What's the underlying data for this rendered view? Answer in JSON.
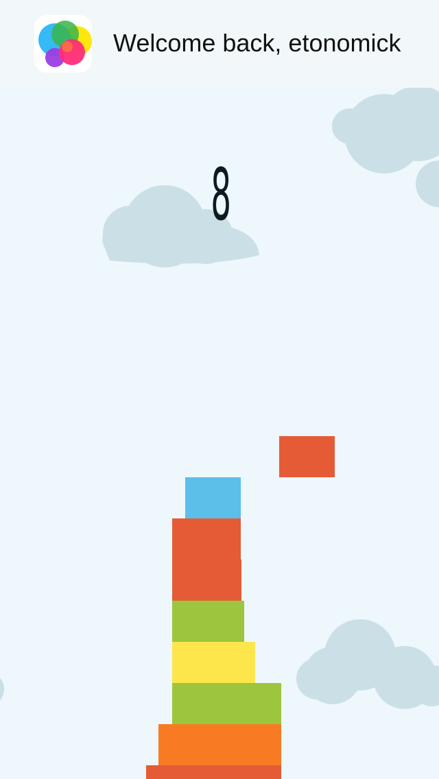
{
  "banner": {
    "icon": "game-center-icon",
    "welcome_text": "Welcome back, etonomick"
  },
  "game": {
    "score": "8",
    "colors": {
      "sky": "#eef7fb",
      "cloud": "#cbe0e6",
      "red": "#e45b36",
      "blue": "#5bbfea",
      "green": "#9dc53d",
      "yellow": "#fde64b",
      "orange": "#f87b23"
    },
    "moving_block": {
      "color": "red"
    },
    "stack_blocks": [
      {
        "color": "blue"
      },
      {
        "color": "red"
      },
      {
        "color": "red"
      },
      {
        "color": "green"
      },
      {
        "color": "yellow"
      },
      {
        "color": "green"
      },
      {
        "color": "orange"
      },
      {
        "color": "red"
      }
    ]
  }
}
